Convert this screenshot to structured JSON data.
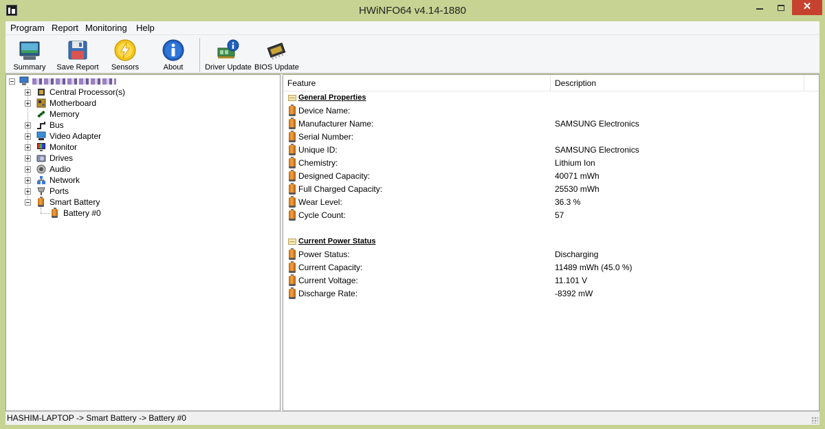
{
  "window": {
    "title": "HWiNFO64 v4.14-1880",
    "close_glyph": "✕"
  },
  "menu": [
    "Program",
    "Report",
    "Monitoring",
    "Help"
  ],
  "toolbar": [
    {
      "label": "Summary",
      "icon": "summary-icon"
    },
    {
      "label": "Save Report",
      "icon": "floppy-icon"
    },
    {
      "label": "Sensors",
      "icon": "sensors-icon"
    },
    {
      "label": "About",
      "icon": "info-icon"
    },
    {
      "label": "Driver Update",
      "icon": "driver-update-icon"
    },
    {
      "label": "BIOS Update",
      "icon": "bios-chip-icon"
    }
  ],
  "tree": {
    "root_label": "",
    "items": [
      {
        "label": "Central Processor(s)",
        "icon": "cpu-icon"
      },
      {
        "label": "Motherboard",
        "icon": "motherboard-icon"
      },
      {
        "label": "Memory",
        "icon": "memory-icon"
      },
      {
        "label": "Bus",
        "icon": "bus-icon"
      },
      {
        "label": "Video Adapter",
        "icon": "video-adapter-icon"
      },
      {
        "label": "Monitor",
        "icon": "monitor-icon"
      },
      {
        "label": "Drives",
        "icon": "drives-icon"
      },
      {
        "label": "Audio",
        "icon": "audio-icon"
      },
      {
        "label": "Network",
        "icon": "network-icon"
      },
      {
        "label": "Ports",
        "icon": "ports-icon"
      },
      {
        "label": "Smart Battery",
        "icon": "battery-icon"
      }
    ],
    "child": {
      "label": "Battery #0",
      "icon": "battery-icon"
    }
  },
  "list": {
    "columns": [
      "Feature",
      "Description"
    ],
    "sections": [
      {
        "title": "General Properties",
        "rows": [
          {
            "feature": "Device Name:",
            "value": ""
          },
          {
            "feature": "Manufacturer Name:",
            "value": "SAMSUNG Electronics"
          },
          {
            "feature": "Serial Number:",
            "value": ""
          },
          {
            "feature": "Unique ID:",
            "value": "SAMSUNG Electronics"
          },
          {
            "feature": "Chemistry:",
            "value": "Lithium Ion"
          },
          {
            "feature": "Designed Capacity:",
            "value": "40071 mWh"
          },
          {
            "feature": "Full Charged Capacity:",
            "value": "25530 mWh"
          },
          {
            "feature": "Wear Level:",
            "value": "36.3 %"
          },
          {
            "feature": "Cycle Count:",
            "value": "57"
          }
        ]
      },
      {
        "title": "Current Power Status",
        "rows": [
          {
            "feature": "Power Status:",
            "value": "Discharging"
          },
          {
            "feature": "Current Capacity:",
            "value": "11489 mWh (45.0 %)"
          },
          {
            "feature": "Current Voltage:",
            "value": "11.101 V"
          },
          {
            "feature": "Discharge Rate:",
            "value": "-8392 mW"
          }
        ]
      }
    ]
  },
  "status": {
    "text": "HASHIM-LAPTOP -> Smart Battery -> Battery #0"
  }
}
